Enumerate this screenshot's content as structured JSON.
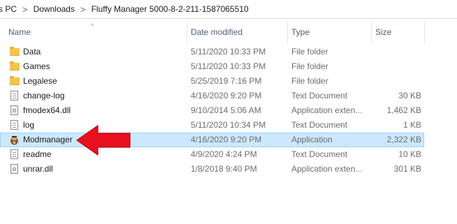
{
  "breadcrumb": {
    "items": [
      "s PC",
      "Downloads",
      "Fluffy Manager 5000-8-2-211-1587065510"
    ],
    "separator": ">"
  },
  "columns": {
    "name": "Name",
    "date_modified": "Date modified",
    "type": "Type",
    "size": "Size"
  },
  "sort_indicator": "^",
  "files": [
    {
      "name": "Data",
      "date": "5/11/2020 10:33 PM",
      "type": "File folder",
      "size": "",
      "icon": "folder-icon"
    },
    {
      "name": "Games",
      "date": "5/11/2020 10:33 PM",
      "type": "File folder",
      "size": "",
      "icon": "folder-icon"
    },
    {
      "name": "Legalese",
      "date": "5/25/2019 7:16 PM",
      "type": "File folder",
      "size": "",
      "icon": "folder-icon"
    },
    {
      "name": "change-log",
      "date": "4/16/2020 9:20 PM",
      "type": "Text Document",
      "size": "30 KB",
      "icon": "text-document-icon"
    },
    {
      "name": "fmodex64.dll",
      "date": "9/10/2014 5:06 AM",
      "type": "Application exten...",
      "size": "1,462 KB",
      "icon": "dll-icon"
    },
    {
      "name": "log",
      "date": "5/11/2020 10:34 PM",
      "type": "Text Document",
      "size": "1 KB",
      "icon": "text-document-icon"
    },
    {
      "name": "Modmanager",
      "date": "4/16/2020 9:20 PM",
      "type": "Application",
      "size": "2,322 KB",
      "icon": "application-icon"
    },
    {
      "name": "readme",
      "date": "4/9/2020 4:24 PM",
      "type": "Text Document",
      "size": "10 KB",
      "icon": "text-document-icon"
    },
    {
      "name": "unrar.dll",
      "date": "1/8/2018 9:40 PM",
      "type": "Application exten...",
      "size": "301 KB",
      "icon": "dll-icon"
    }
  ],
  "selected_file": "Modmanager",
  "colors": {
    "selection": "#cce8ff",
    "header_text": "#4c607a",
    "annotation_arrow": "#e8101e"
  }
}
